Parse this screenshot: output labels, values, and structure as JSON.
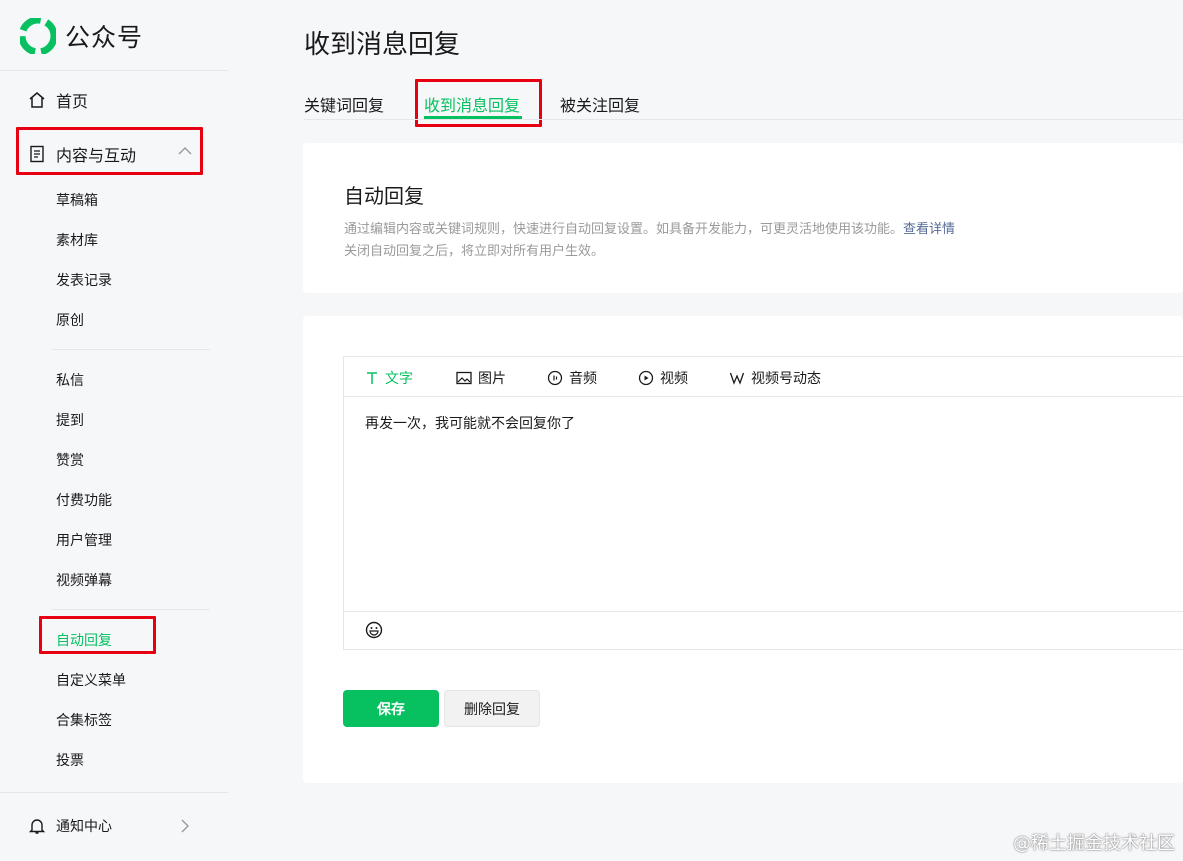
{
  "app": {
    "name": "公众号"
  },
  "sidebar": {
    "home": "首页",
    "content_group": "内容与互动",
    "items_a": [
      "草稿箱",
      "素材库",
      "发表记录",
      "原创"
    ],
    "items_b": [
      "私信",
      "提到",
      "赞赏",
      "付费功能",
      "用户管理",
      "视频弹幕"
    ],
    "items_c": [
      "自动回复",
      "自定义菜单",
      "合集标签",
      "投票"
    ],
    "active_item": "自动回复",
    "notify": "通知中心"
  },
  "page": {
    "title": "收到消息回复",
    "tabs": [
      "关键词回复",
      "收到消息回复",
      "被关注回复"
    ],
    "active_tab": "收到消息回复"
  },
  "auto_reply": {
    "title": "自动回复",
    "desc_line1": "通过编辑内容或关键词规则，快速进行自动回复设置。如具备开发能力，可更灵活地使用该功能。",
    "desc_link": "查看详情",
    "desc_line2": "关闭自动回复之后，将立即对所有用户生效。"
  },
  "editor": {
    "tools": [
      "文字",
      "图片",
      "音频",
      "视频",
      "视频号动态"
    ],
    "active_tool": "文字",
    "content": "再发一次，我可能就不会回复你了"
  },
  "buttons": {
    "save": "保存",
    "delete": "删除回复"
  },
  "watermark": "@稀土掘金技术社区",
  "colors": {
    "accent": "#07c160",
    "highlight_box": "#e60012",
    "link": "#576b95"
  }
}
